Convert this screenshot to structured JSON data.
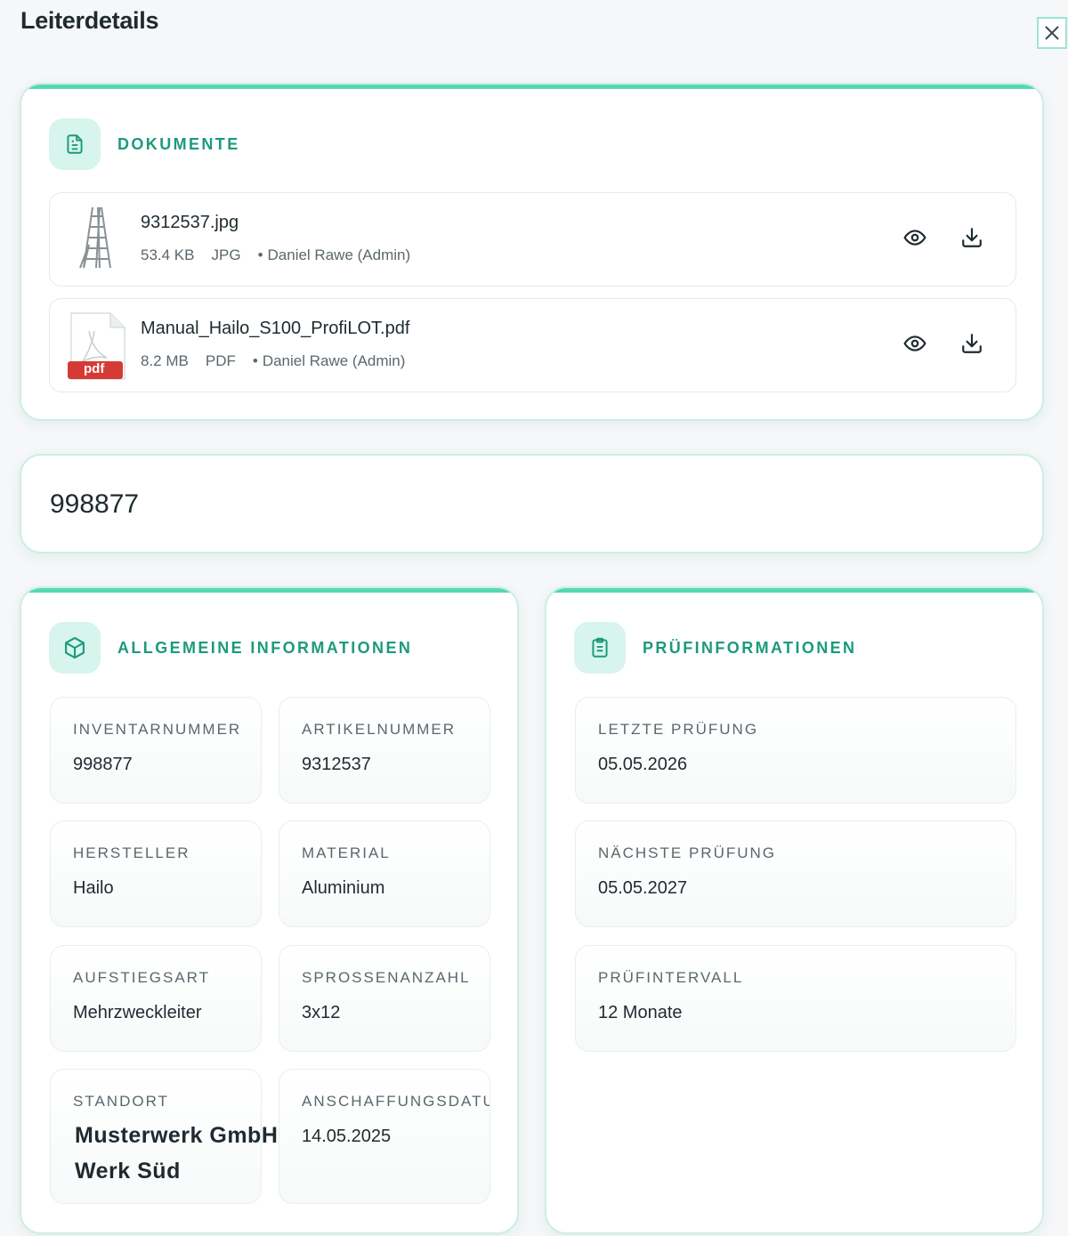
{
  "header": {
    "title": "Leiterdetails"
  },
  "documents": {
    "title": "DOKUMENTE",
    "files": [
      {
        "name": "9312537.jpg",
        "size": "53.4 KB",
        "type": "JPG",
        "uploader": "Daniel Rawe (Admin)",
        "thumb_icon": "ladder-thumbnail-icon"
      },
      {
        "name": "Manual_Hailo_S100_ProfiLOT.pdf",
        "size": "8.2 MB",
        "type": "PDF",
        "uploader": "Daniel Rawe (Admin)",
        "thumb_icon": "pdf-file-icon",
        "thumb_label": "pdf"
      }
    ],
    "bullet": "•"
  },
  "identifier": {
    "value": "998877"
  },
  "general": {
    "title": "ALLGEMEINE INFORMATIONEN",
    "fields": [
      {
        "label": "INVENTARNUMMER",
        "value": "998877"
      },
      {
        "label": "ARTIKELNUMMER",
        "value": "9312537"
      },
      {
        "label": "HERSTELLER",
        "value": "Hailo"
      },
      {
        "label": "MATERIAL",
        "value": "Aluminium"
      },
      {
        "label": "AUFSTIEGSART",
        "value": "Mehrzweckleiter"
      },
      {
        "label": "SPROSSENANZAHL",
        "value": "3x12"
      },
      {
        "label": "STANDORT",
        "value": "Musterwerk GmbH, Werk Süd"
      },
      {
        "label": "ANSCHAFFUNGSDATUM",
        "value": "14.05.2025"
      }
    ]
  },
  "inspection": {
    "title": "PRÜFINFORMATIONEN",
    "fields": [
      {
        "label": "LETZTE PRÜFUNG",
        "value": "05.05.2026"
      },
      {
        "label": "NÄCHSTE PRÜFUNG",
        "value": "05.05.2027"
      },
      {
        "label": "PRÜFINTERVALL",
        "value": "12 Monate"
      }
    ]
  },
  "colors": {
    "accent": "#55d8b2",
    "accent_text": "#1c9a7c",
    "icon_bg": "#d7f5ec",
    "pdf_red": "#d63a34"
  }
}
